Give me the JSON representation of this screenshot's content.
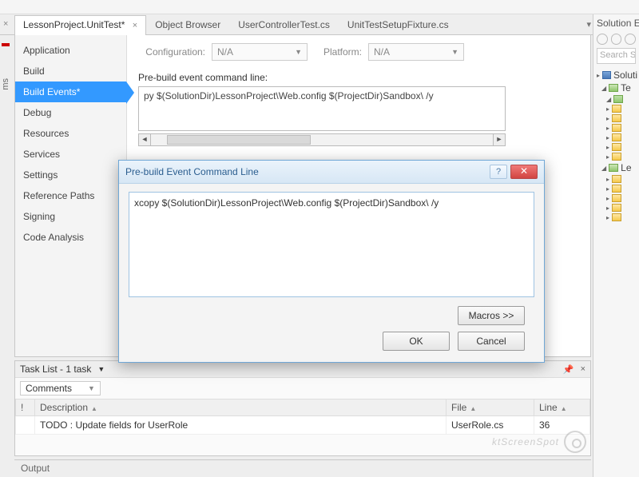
{
  "tabs": {
    "items": [
      {
        "label": "LessonProject.UnitTest*",
        "active": true
      },
      {
        "label": "Object Browser",
        "active": false
      },
      {
        "label": "UserControllerTest.cs",
        "active": false
      },
      {
        "label": "UnitTestSetupFixture.cs",
        "active": false
      }
    ],
    "close_glyph": "×",
    "scroll_glyph": "▾"
  },
  "left_gutter_text": "ms",
  "sidenav": {
    "items": [
      "Application",
      "Build",
      "Build Events*",
      "Debug",
      "Resources",
      "Services",
      "Settings",
      "Reference Paths",
      "Signing",
      "Code Analysis"
    ],
    "active_index": 2
  },
  "config_row": {
    "config_label": "Configuration:",
    "config_value": "N/A",
    "platform_label": "Platform:",
    "platform_value": "N/A"
  },
  "prebuild": {
    "label": "Pre-build event command line:",
    "text": "py $(SolutionDir)LessonProject\\Web.config $(ProjectDir)Sandbox\\ /y"
  },
  "dialog": {
    "title": "Pre-build Event Command Line",
    "text": "xcopy $(SolutionDir)LessonProject\\Web.config $(ProjectDir)Sandbox\\ /y",
    "macros_btn": "Macros >>",
    "ok_btn": "OK",
    "cancel_btn": "Cancel",
    "help_glyph": "?",
    "close_glyph": "✕"
  },
  "solution_explorer": {
    "title": "Solution Ex",
    "search_placeholder": "Search Solu",
    "nodes": [
      {
        "kind": "sol",
        "label": "Soluti",
        "expand": "▸"
      },
      {
        "kind": "proj",
        "label": "Te",
        "expand": "◢"
      },
      {
        "kind": "cs",
        "label": "",
        "expand": "◢"
      },
      {
        "kind": "fold",
        "label": "",
        "expand": "▸"
      },
      {
        "kind": "fold",
        "label": "",
        "expand": "▸"
      },
      {
        "kind": "fold",
        "label": "",
        "expand": "▸"
      },
      {
        "kind": "fold",
        "label": "",
        "expand": "▸"
      },
      {
        "kind": "fold",
        "label": "",
        "expand": "▸"
      },
      {
        "kind": "fold",
        "label": "",
        "expand": "▸"
      },
      {
        "kind": "proj",
        "label": "Le",
        "expand": "◢"
      },
      {
        "kind": "fold",
        "label": "",
        "expand": "▸"
      },
      {
        "kind": "fold",
        "label": "",
        "expand": "▸"
      },
      {
        "kind": "fold",
        "label": "",
        "expand": "▸"
      },
      {
        "kind": "fold",
        "label": "",
        "expand": "▸"
      },
      {
        "kind": "fold",
        "label": "",
        "expand": "▸"
      }
    ]
  },
  "tasklist": {
    "title": "Task List - 1 task",
    "filter": "Comments",
    "columns": {
      "c0": "!",
      "c1": "Description",
      "c2": "File",
      "c3": "Line"
    },
    "rows": [
      {
        "desc": "TODO : Update fields for UserRole",
        "file": "UserRole.cs",
        "line": "36"
      }
    ]
  },
  "output_title": "Output",
  "watermark": "ktScreenSpot"
}
